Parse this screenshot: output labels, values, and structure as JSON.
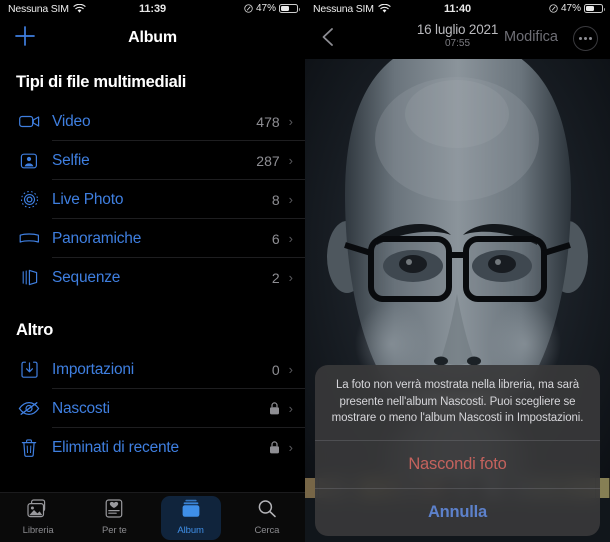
{
  "left": {
    "status": {
      "carrier": "Nessuna SIM",
      "wifi_icon": "wifi-icon",
      "time": "11:39",
      "location_icon": "location-icon",
      "battery": "47%"
    },
    "nav": {
      "add_icon": "plus-icon",
      "title": "Album"
    },
    "sections": [
      {
        "title": "Tipi di file multimediali",
        "rows": [
          {
            "icon": "video-camera-icon",
            "label": "Video",
            "count": "478",
            "chevron": "›",
            "locked": false
          },
          {
            "icon": "selfie-person-icon",
            "label": "Selfie",
            "count": "287",
            "chevron": "›",
            "locked": false
          },
          {
            "icon": "live-photo-icon",
            "label": "Live Photo",
            "count": "8",
            "chevron": "›",
            "locked": false
          },
          {
            "icon": "panorama-icon",
            "label": "Panoramiche",
            "count": "6",
            "chevron": "›",
            "locked": false
          },
          {
            "icon": "burst-sequence-icon",
            "label": "Sequenze",
            "count": "2",
            "chevron": "›",
            "locked": false
          }
        ]
      },
      {
        "title": "Altro",
        "rows": [
          {
            "icon": "import-download-icon",
            "label": "Importazioni",
            "count": "0",
            "chevron": "›",
            "locked": false
          },
          {
            "icon": "eye-slash-icon",
            "label": "Nascosti",
            "count": "",
            "chevron": "›",
            "locked": true
          },
          {
            "icon": "trash-icon",
            "label": "Eliminati di recente",
            "count": "",
            "chevron": "›",
            "locked": true
          }
        ]
      }
    ],
    "tabs": [
      {
        "icon": "library-photos-icon",
        "label": "Libreria",
        "active": false
      },
      {
        "icon": "for-you-card-icon",
        "label": "Per te",
        "active": false
      },
      {
        "icon": "albums-stack-icon",
        "label": "Album",
        "active": true
      },
      {
        "icon": "search-icon",
        "label": "Cerca",
        "active": false
      }
    ]
  },
  "right": {
    "status": {
      "carrier": "Nessuna SIM",
      "wifi_icon": "wifi-icon",
      "time": "11:40",
      "location_icon": "location-icon",
      "battery": "47%"
    },
    "nav": {
      "back_icon": "chevron-left-icon",
      "date": "16 luglio 2021",
      "time": "07:55",
      "edit_label": "Modifica",
      "more_icon": "ellipsis-circle-icon"
    },
    "photo": {
      "alt": "portrait-photo-man-with-glasses"
    },
    "sheet": {
      "message": "La foto non verrà mostrata nella libreria, ma sarà presente nell'album Nascosti. Puoi scegliere se mostrare o meno l'album Nascosti in Impostazioni.",
      "destructive_label": "Nascondi foto",
      "cancel_label": "Annulla"
    }
  },
  "colors": {
    "accent_blue": "#3f7fe0",
    "destructive_red": "#c4625d",
    "cancel_blue": "#5d81cb",
    "secondary_text": "#8e8e93",
    "tab_active": "#3f8fe8"
  }
}
